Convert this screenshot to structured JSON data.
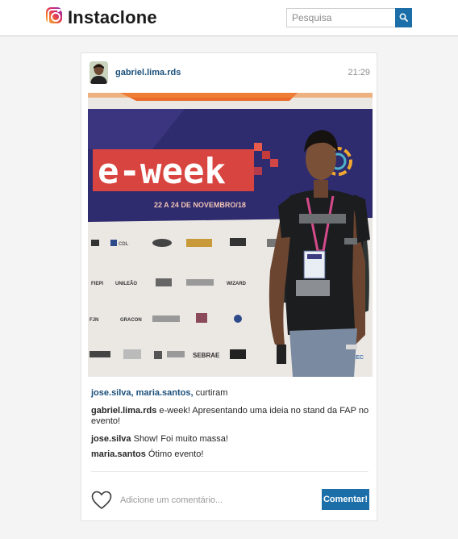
{
  "header": {
    "brand": "Instaclone",
    "search_placeholder": "Pesquisa",
    "search_value": ""
  },
  "post": {
    "username": "gabriel.lima.rds",
    "time": "21:29",
    "photo_text": {
      "banner_title": "e-week",
      "banner_date": "22 A 24 DE NOVEMBRO/18",
      "sponsor_labels": [
        "CDL",
        "FIEPI",
        "FJN",
        "GRACON",
        "UNILEÃO",
        "WIZARD",
        "SEBRAE",
        "FIEC"
      ]
    },
    "likes": {
      "names": "jose.silva, maria.santos,",
      "suffix": " curtiram"
    },
    "caption": {
      "user": "gabriel.lima.rds",
      "text": " e-week! Apresentando uma ideia no stand da FAP no evento!"
    },
    "comments": [
      {
        "user": "jose.silva",
        "text": " Show! Foi muito massa!"
      },
      {
        "user": "maria.santos",
        "text": " Ótimo evento!"
      }
    ],
    "comment_placeholder": "Adicione um comentário...",
    "comment_button": "Comentar!"
  },
  "icons": {
    "logo": "instagram-logo-icon",
    "search": "search-icon",
    "like": "heart-icon"
  },
  "colors": {
    "accent": "#1b6ea8",
    "link": "#1b4f7a",
    "banner": "#2e2b6e",
    "banner_red": "#e2403f"
  }
}
